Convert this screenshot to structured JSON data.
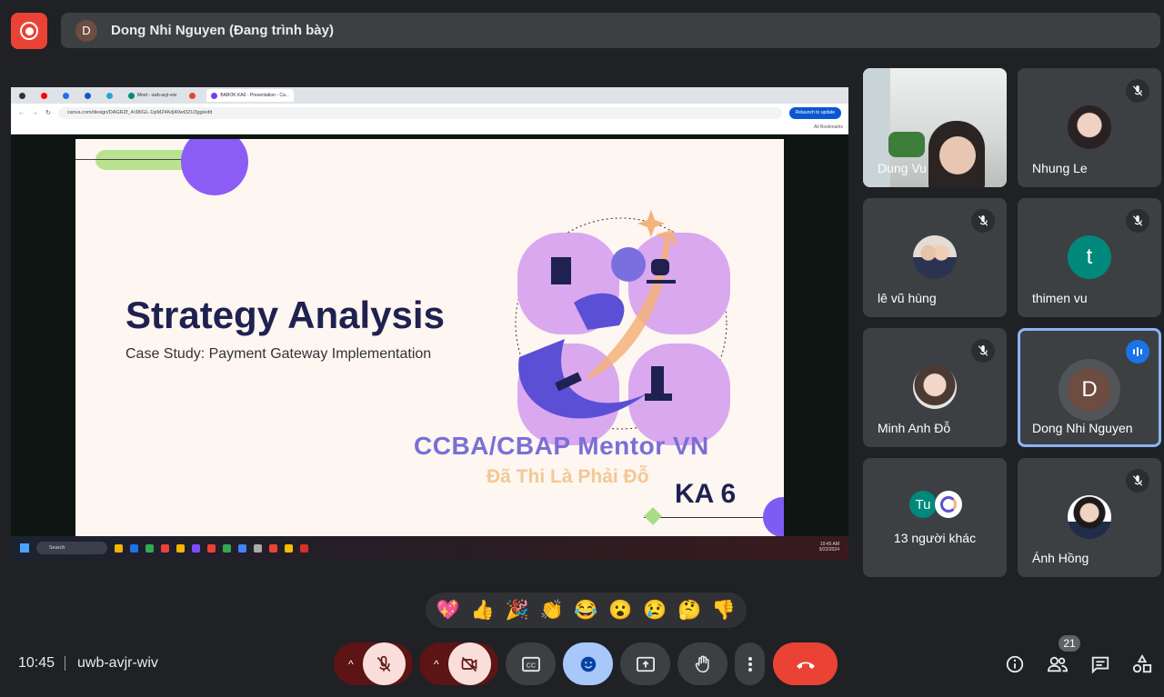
{
  "presenter": {
    "avatar_letter": "D",
    "label": "Dong Nhi Nguyen (Đang trình bày)"
  },
  "browser": {
    "tabs": [
      {
        "label": "",
        "color": "#333"
      },
      {
        "label": "",
        "color": "#ff0000"
      },
      {
        "label": "",
        "color": "#1a73e8"
      },
      {
        "label": "",
        "color": "#0b57d0"
      },
      {
        "label": "",
        "color": "#2aa3d7"
      },
      {
        "label": "Meet - uwb-avjr-wiv",
        "color": "#00897b"
      },
      {
        "label": "",
        "color": "#ea4335"
      },
      {
        "label": "BABOK KA6 - Presentation - Ca...",
        "color": "#7c3aed"
      }
    ],
    "url": "canva.com/design/DAGRZf_4r38/GL-1ipMZ4Kdj40wt3ZU3gg/edit",
    "relaunch_label": "Relaunch to update",
    "bookmarks_label": "All Bookmarks"
  },
  "slide": {
    "title": "Strategy Analysis",
    "subtitle": "Case Study: Payment Gateway Implementation",
    "brand": "CCBA/CBAP Mentor VN",
    "tagline": "Đã Thi Là Phải Đỗ",
    "ka_label": "KA 6"
  },
  "taskbar": {
    "search_label": "Search",
    "time": "10:45 AM",
    "date": "9/22/2024"
  },
  "participants": [
    {
      "name": "Dung Vu",
      "type": "video",
      "muted": false
    },
    {
      "name": "Nhung Le",
      "type": "photo",
      "muted": true
    },
    {
      "name": "lê vũ hùng",
      "type": "photo",
      "muted": true
    },
    {
      "name": "thimen vu",
      "type": "letter",
      "letter": "t",
      "color": "#00897b",
      "muted": true
    },
    {
      "name": "Minh Anh Đỗ",
      "type": "photo",
      "muted": true
    },
    {
      "name": "Dong Nhi Nguyen",
      "type": "letter",
      "letter": "D",
      "color": "#6d4c41",
      "muted": false,
      "speaking": true
    },
    {
      "name": "13 người khác",
      "type": "group",
      "letter": "Tu",
      "color": "#00897b"
    },
    {
      "name": "Ánh Hồng",
      "type": "photo",
      "muted": true
    }
  ],
  "reactions": [
    "💖",
    "👍",
    "🎉",
    "👏",
    "😂",
    "😮",
    "😢",
    "🤔",
    "👎"
  ],
  "footer": {
    "time": "10:45",
    "meeting_code": "uwb-avjr-wiv",
    "people_count": "21"
  },
  "colors": {
    "background": "#202124",
    "tile": "#3c4043",
    "leave": "#ea4335",
    "active_blue": "#8ab4f8",
    "muted_red": "#f9dedc"
  }
}
